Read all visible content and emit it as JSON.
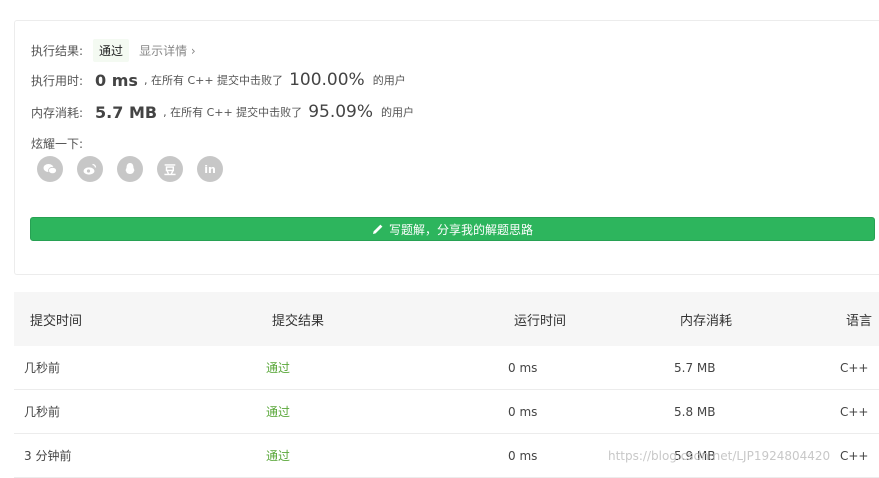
{
  "result": {
    "label": "执行结果:",
    "status": "通过",
    "details_link": "显示详情 ›"
  },
  "runtime": {
    "label": "执行用时:",
    "value": "0 ms",
    "mid_text": ", 在所有 C++ 提交中击败了",
    "percent": "100.00%",
    "suffix": "的用户"
  },
  "memory": {
    "label": "内存消耗:",
    "value": "5.7 MB",
    "mid_text": ", 在所有 C++ 提交中击败了",
    "percent": "95.09%",
    "suffix": "的用户"
  },
  "share": {
    "label": "炫耀一下:",
    "icons": [
      {
        "name": "wechat-icon",
        "glyph": ""
      },
      {
        "name": "weibo-icon",
        "glyph": ""
      },
      {
        "name": "qq-icon",
        "glyph": ""
      },
      {
        "name": "douban-icon",
        "glyph": "豆"
      },
      {
        "name": "linkedin-icon",
        "glyph": "in"
      }
    ]
  },
  "write_button": {
    "label": "写题解，分享我的解题思路"
  },
  "table": {
    "headers": [
      "提交时间",
      "提交结果",
      "运行时间",
      "内存消耗",
      "语言"
    ],
    "rows": [
      [
        "几秒前",
        "通过",
        "0 ms",
        "5.7 MB",
        "C++"
      ],
      [
        "几秒前",
        "通过",
        "0 ms",
        "5.8 MB",
        "C++"
      ],
      [
        "3 分钟前",
        "通过",
        "0 ms",
        "5.9 MB",
        "C++"
      ]
    ]
  },
  "watermark": "https://blog.csdn.net/LJP1924804420",
  "colors": {
    "accent_green": "#2db55d",
    "pass_text": "#5aa73a",
    "icon_gray": "#c7c7c7"
  }
}
